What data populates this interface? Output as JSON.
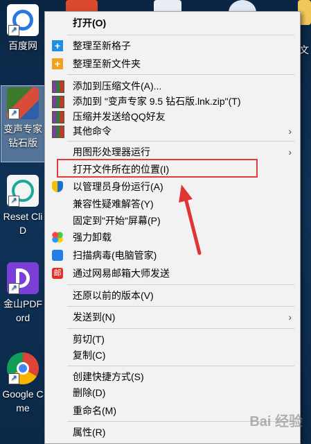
{
  "desktop": {
    "icons": [
      {
        "label_lines": [
          "百度网"
        ],
        "name": "baidu-netdisk"
      },
      {
        "label_lines": [
          "变声专家",
          "钻石版"
        ],
        "name": "voice-changer"
      },
      {
        "label_lines": [
          "Reset Cli",
          "D"
        ],
        "name": "reset-client"
      },
      {
        "label_lines": [
          "金山PDF",
          "ord"
        ],
        "name": "kingsoft-pdf"
      },
      {
        "label_lines": [
          "Google C",
          "me"
        ],
        "name": "google-chrome"
      }
    ],
    "right_partial_label": "建文"
  },
  "menu": {
    "items": [
      {
        "label": "打开(O)"
      },
      {
        "label": "整理至新格子"
      },
      {
        "label": "整理至新文件夹"
      },
      {
        "label": "添加到压缩文件(A)..."
      },
      {
        "label": "添加到 \"变声专家 9.5 钻石版.lnk.zip\"(T)"
      },
      {
        "label": "压缩并发送给QQ好友"
      },
      {
        "label": "其他命令"
      },
      {
        "label": "用图形处理器运行"
      },
      {
        "label": "打开文件所在的位置(I)"
      },
      {
        "label": "以管理员身份运行(A)"
      },
      {
        "label": "兼容性疑难解答(Y)"
      },
      {
        "label": "固定到\"开始\"屏幕(P)"
      },
      {
        "label": "强力卸载"
      },
      {
        "label": "扫描病毒(电脑管家)"
      },
      {
        "label": "通过网易邮箱大师发送"
      },
      {
        "label": "还原以前的版本(V)"
      },
      {
        "label": "发送到(N)"
      },
      {
        "label": "剪切(T)"
      },
      {
        "label": "复制(C)"
      },
      {
        "label": "创建快捷方式(S)"
      },
      {
        "label": "删除(D)"
      },
      {
        "label": "重命名(M)"
      },
      {
        "label": "属性(R)"
      }
    ],
    "submenu_glyph": "›"
  },
  "icons": {
    "plus_glyph": "+",
    "mail_glyph": "邮"
  },
  "watermark": "Bai 经验"
}
